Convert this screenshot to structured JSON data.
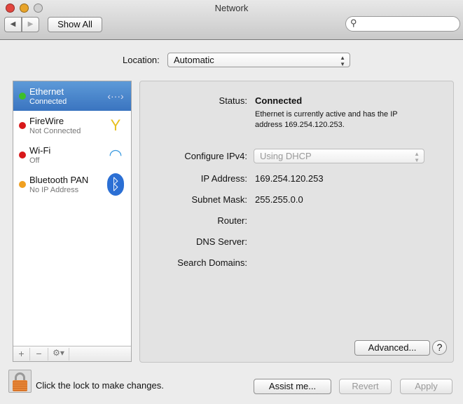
{
  "window": {
    "title": "Network"
  },
  "toolbar": {
    "back": "◀",
    "forward": "▶",
    "show_all": "Show All",
    "search_placeholder": ""
  },
  "location": {
    "label": "Location:",
    "value": "Automatic"
  },
  "services": [
    {
      "name": "Ethernet",
      "status": "Connected",
      "dot": "#3cbf2a",
      "icon": "ethernet-icon",
      "glyph": "‹···›",
      "selected": true
    },
    {
      "name": "FireWire",
      "status": "Not Connected",
      "dot": "#d8181a",
      "icon": "firewire-icon",
      "glyph": "Y"
    },
    {
      "name": "Wi-Fi",
      "status": "Off",
      "dot": "#d8181a",
      "icon": "wifi-icon",
      "glyph": "◠"
    },
    {
      "name": "Bluetooth PAN",
      "status": "No IP Address",
      "dot": "#f0a020",
      "icon": "bluetooth-icon",
      "glyph": "ᛒ"
    }
  ],
  "list_bar": {
    "add": "+",
    "remove": "−",
    "gear": "⚙▾"
  },
  "detail": {
    "status_label": "Status:",
    "status_value": "Connected",
    "status_desc_1": "Ethernet is currently active and has the IP",
    "status_desc_2": "address 169.254.120.253.",
    "configure_label": "Configure IPv4:",
    "configure_value": "Using DHCP",
    "ip_label": "IP Address:",
    "ip_value": "169.254.120.253",
    "subnet_label": "Subnet Mask:",
    "subnet_value": "255.255.0.0",
    "router_label": "Router:",
    "dns_label": "DNS Server:",
    "search_domains_label": "Search Domains:",
    "advanced": "Advanced...",
    "help": "?"
  },
  "footer": {
    "lock_text": "Click the lock to make changes.",
    "assist": "Assist me...",
    "revert": "Revert",
    "apply": "Apply"
  }
}
